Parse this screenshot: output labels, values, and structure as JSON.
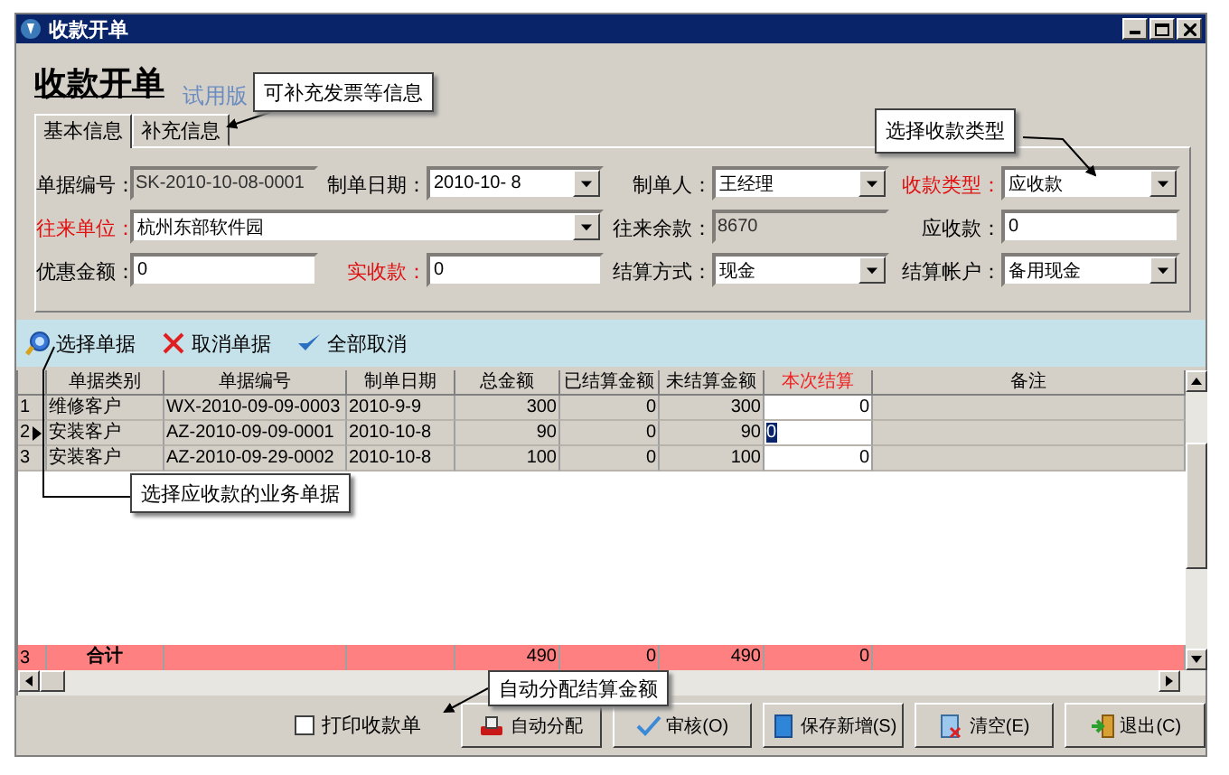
{
  "window": {
    "title": "收款开单"
  },
  "header": {
    "title": "收款开单",
    "trial_badge": "试用版"
  },
  "tabs": [
    {
      "label": "基本信息",
      "selected": true
    },
    {
      "label": "补充信息",
      "selected": false
    }
  ],
  "form": {
    "rows": [
      {
        "fields": [
          {
            "label": "单据编号：",
            "value": "SK-2010-10-08-0001",
            "kind": "readonly",
            "required": false
          },
          {
            "label": "制单日期：",
            "value": "2010-10-  8",
            "kind": "dropdown",
            "required": false
          },
          {
            "label": "制单人：",
            "value": "王经理",
            "kind": "dropdown",
            "required": false
          },
          {
            "label": "收款类型：",
            "value": "应收款",
            "kind": "dropdown",
            "required": true
          }
        ]
      },
      {
        "fields": [
          {
            "label": "往来单位：",
            "value": "杭州东部软件园",
            "kind": "dropdown",
            "required": true
          },
          {
            "label": "往来余款：",
            "value": "8670",
            "kind": "readonly",
            "required": false
          },
          {
            "label": "应收款：",
            "value": "0",
            "kind": "text",
            "required": false
          }
        ]
      },
      {
        "fields": [
          {
            "label": "优惠金额：",
            "value": "0",
            "kind": "text",
            "required": false
          },
          {
            "label": "实收款：",
            "value": "0",
            "kind": "text",
            "required": true
          },
          {
            "label": "结算方式：",
            "value": "现金",
            "kind": "dropdown",
            "required": false
          },
          {
            "label": "结算帐户：",
            "value": "备用现金",
            "kind": "dropdown",
            "required": false
          }
        ]
      }
    ]
  },
  "toolbar": [
    {
      "label": "选择单据",
      "kind": "select"
    },
    {
      "label": "取消单据",
      "kind": "cancel"
    },
    {
      "label": "全部取消",
      "kind": "clear-all"
    }
  ],
  "table": {
    "columns": [
      {
        "label": "单据类别",
        "kind": "text",
        "editable": false
      },
      {
        "label": "单据编号",
        "kind": "text",
        "editable": false
      },
      {
        "label": "制单日期",
        "kind": "text",
        "editable": false
      },
      {
        "label": "总金额",
        "kind": "number",
        "editable": false
      },
      {
        "label": "已结算金额",
        "kind": "number",
        "editable": false
      },
      {
        "label": "未结算金额",
        "kind": "number",
        "editable": false
      },
      {
        "label": "本次结算",
        "kind": "number",
        "editable": true
      },
      {
        "label": "备注",
        "kind": "text",
        "editable": false
      }
    ],
    "rows": [
      {
        "number": "1",
        "selected": false,
        "cells": [
          "维修客户",
          "WX-2010-09-09-0003",
          "2010-9-9",
          "300",
          "0",
          "300",
          "0"
        ]
      },
      {
        "number": "2",
        "selected": true,
        "cells": [
          "安装客户",
          "AZ-2010-09-09-0001",
          "2010-10-8",
          "90",
          "0",
          "90",
          "0"
        ]
      },
      {
        "number": "3",
        "selected": false,
        "cells": [
          "安装客户",
          "AZ-2010-09-29-0002",
          "2010-10-8",
          "100",
          "0",
          "100",
          "0"
        ]
      }
    ],
    "total_row": {
      "number": "3",
      "label": "合计",
      "total_amount": "490",
      "settled_amount": "0",
      "unsettled_amount": "490",
      "current_settlement": "0"
    }
  },
  "footer": {
    "print_checkbox": {
      "label": "打印收款单",
      "checked": false
    },
    "buttons": [
      {
        "label": "自动分配",
        "kind": "auto"
      },
      {
        "label": "审核(O)",
        "kind": "approve"
      },
      {
        "label": "保存新增(S)",
        "kind": "save"
      },
      {
        "label": "清空(E)",
        "kind": "clear"
      },
      {
        "label": "退出(C)",
        "kind": "exit"
      }
    ]
  },
  "callouts": [
    {
      "text": "可补充发票等信息"
    },
    {
      "text": "选择收款类型"
    },
    {
      "text": "选择应收款的业务单据"
    },
    {
      "text": "自动分配结算金额"
    }
  ]
}
